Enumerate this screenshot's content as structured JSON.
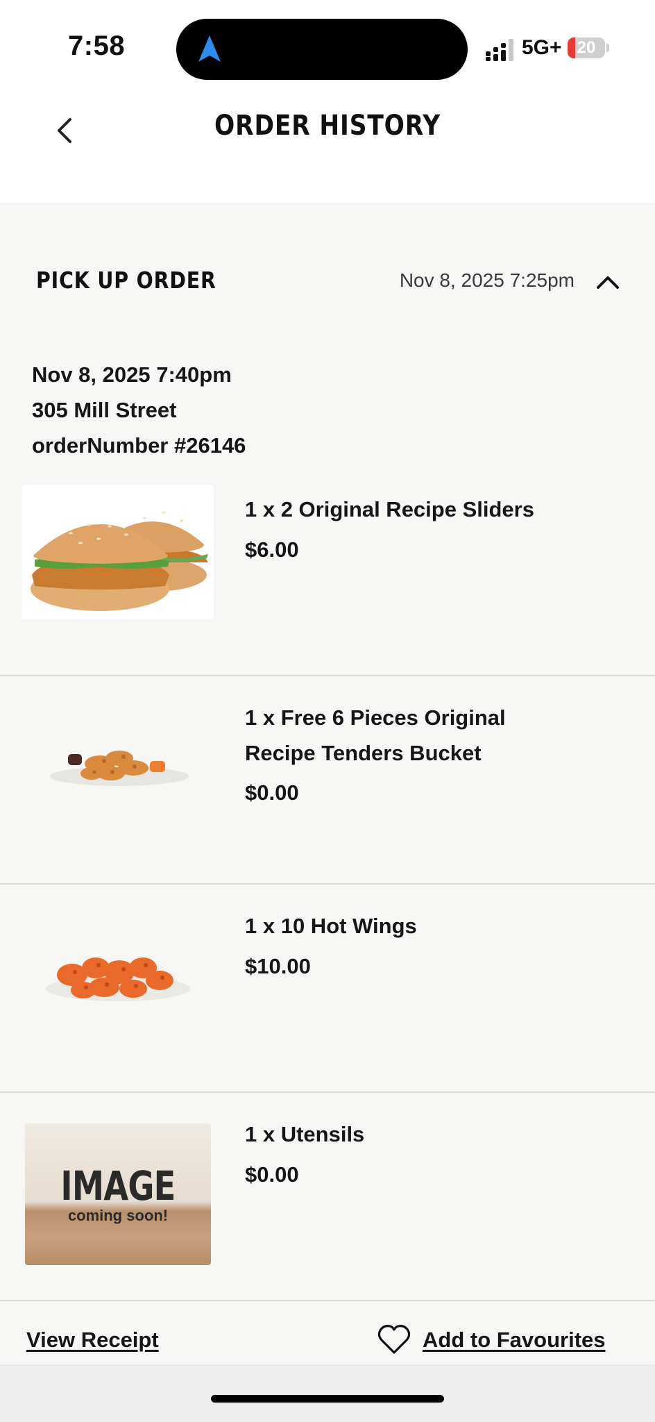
{
  "status_bar": {
    "time": "7:58",
    "network": "5G+",
    "battery_level": 20,
    "battery_text": "20",
    "battery_color": "#e53935",
    "nav_icon": "location-arrow-icon"
  },
  "header": {
    "title": "ORDER HISTORY",
    "back_icon": "chevron-left-icon"
  },
  "order": {
    "type_label": "PICK UP ORDER",
    "placed_at": "Nov 8, 2025 7:25pm",
    "toggle_icon": "chevron-up-icon",
    "pickup_time": "Nov 8, 2025 7:40pm",
    "address": "305 Mill Street",
    "order_number": "orderNumber #26146"
  },
  "items": [
    {
      "name": "1 x 2 Original Recipe Sliders",
      "price": "$6.00",
      "image": "sliders-image"
    },
    {
      "name": "1 x Free 6 Pieces Original Recipe Tenders Bucket",
      "price": "$0.00",
      "image": "tenders-image"
    },
    {
      "name": "1 x 10 Hot Wings",
      "price": "$10.00",
      "image": "wings-image"
    },
    {
      "name": "1 x Utensils",
      "price": "$0.00",
      "image": "placeholder-image",
      "placeholder_big": "IMAGE",
      "placeholder_small": "coming soon!"
    }
  ],
  "actions": {
    "view_receipt": "View Receipt",
    "add_favourites": "Add to Favourites",
    "favourite_icon": "heart-outline-icon"
  }
}
